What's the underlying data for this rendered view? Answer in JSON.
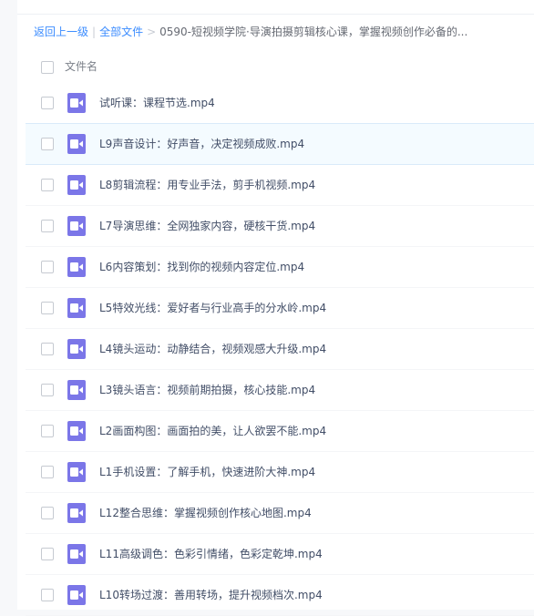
{
  "breadcrumb": {
    "back": "返回上一级",
    "all_files": "全部文件",
    "current": "0590-短视频学院·导演拍摄剪辑核心课，掌握视频创作必备的..."
  },
  "header": {
    "column_name": "文件名"
  },
  "icons": {
    "file_type": "video-file-icon",
    "color": "#7b76e8"
  },
  "files": [
    {
      "name": "试听课：课程节选.mp4"
    },
    {
      "name": "L9声音设计：好声音，决定视频成败.mp4"
    },
    {
      "name": "L8剪辑流程：用专业手法，剪手机视频.mp4"
    },
    {
      "name": "L7导演思维：全网独家内容，硬核干货.mp4"
    },
    {
      "name": "L6内容策划：找到你的视频内容定位.mp4"
    },
    {
      "name": "L5特效光线：爱好者与行业高手的分水岭.mp4"
    },
    {
      "name": "L4镜头运动：动静结合，视频观感大升级.mp4"
    },
    {
      "name": "L3镜头语言：视频前期拍摄，核心技能.mp4"
    },
    {
      "name": "L2画面构图：画面拍的美，让人欲罢不能.mp4"
    },
    {
      "name": "L1手机设置：了解手机，快速进阶大神.mp4"
    },
    {
      "name": "L12整合思维：掌握视频创作核心地图.mp4"
    },
    {
      "name": "L11高级调色：色彩引情绪，色彩定乾坤.mp4"
    },
    {
      "name": "L10转场过渡：善用转场，提升视频档次.mp4"
    }
  ]
}
